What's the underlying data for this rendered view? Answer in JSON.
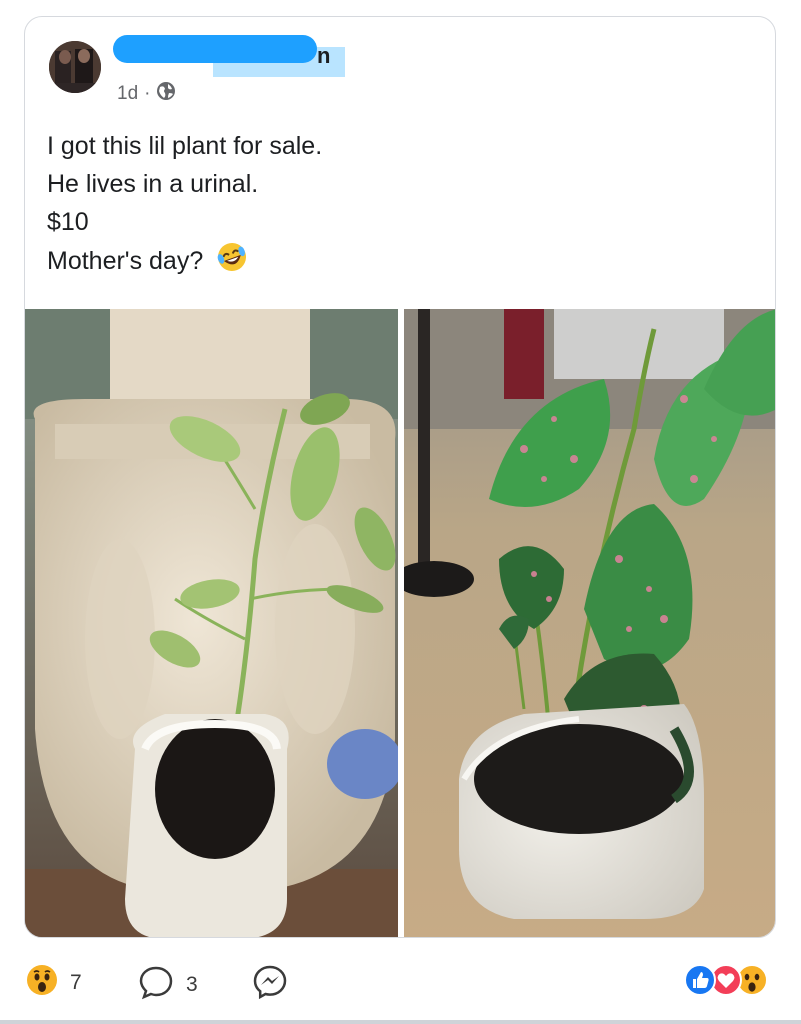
{
  "post": {
    "author_suffix": "n",
    "time": "1d",
    "lines": [
      "I got this lil plant for sale.",
      "He lives in a urinal.",
      "$10",
      "Mother's day?"
    ],
    "emoji_icon": "rolling-laughing-emoji"
  },
  "footer": {
    "wow_count": "7",
    "comment_count": "3"
  },
  "colors": {
    "meta_text": "#65676b",
    "like_blue": "#1877f2",
    "love_red": "#f33e58",
    "wow_yellow": "#f7b125"
  }
}
